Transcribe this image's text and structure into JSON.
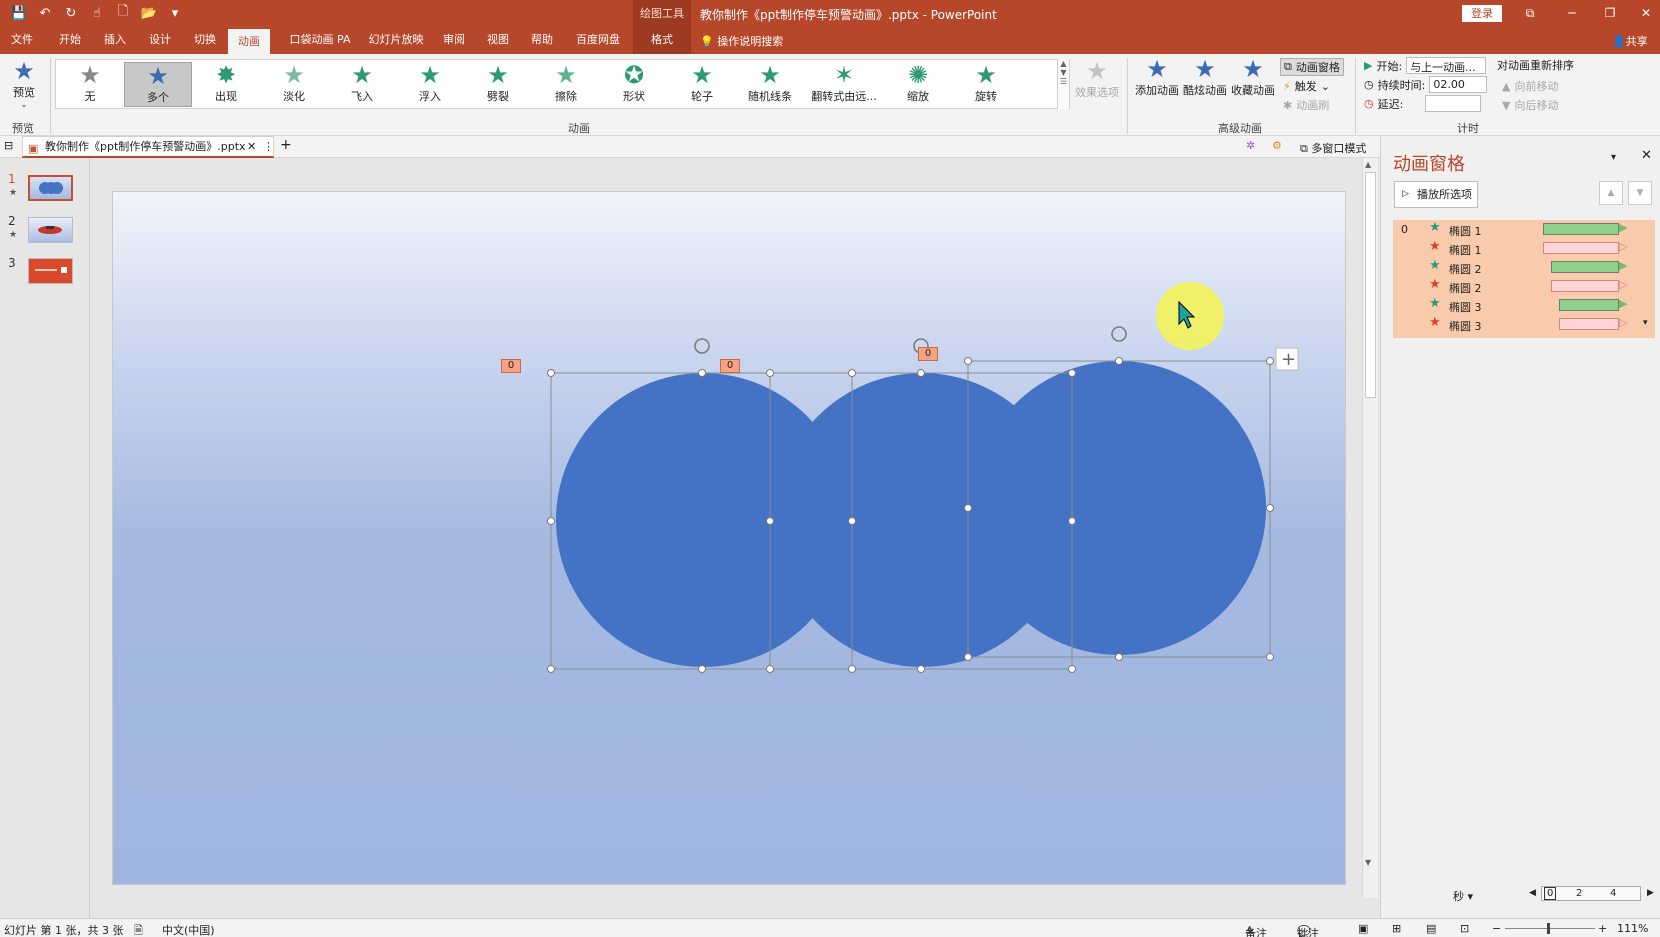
{
  "window": {
    "title": "教你制作《ppt制作停车预警动画》.pptx  -  PowerPoint",
    "context_tool": "绘图工具",
    "login": "登录"
  },
  "tabs": [
    {
      "label": "文件"
    },
    {
      "label": "开始"
    },
    {
      "label": "插入"
    },
    {
      "label": "设计"
    },
    {
      "label": "切换"
    },
    {
      "label": "动画"
    },
    {
      "label": "口袋动画 PA"
    },
    {
      "label": "幻灯片放映"
    },
    {
      "label": "审阅"
    },
    {
      "label": "视图"
    },
    {
      "label": "帮助"
    },
    {
      "label": "百度网盘"
    },
    {
      "label": "格式"
    }
  ],
  "tell_me": "操作说明搜索",
  "share": "共享",
  "ribbon": {
    "preview": {
      "label": "预览",
      "group": "预览"
    },
    "animation_group": "动画",
    "gallery": [
      {
        "label": "无",
        "color": "#888888"
      },
      {
        "label": "多个",
        "color": "#3d6cb3"
      },
      {
        "label": "出现",
        "color": "#2e9a74"
      },
      {
        "label": "淡化",
        "color": "#7fb8a3"
      },
      {
        "label": "飞入",
        "color": "#2e9a74"
      },
      {
        "label": "浮入",
        "color": "#2e9a74"
      },
      {
        "label": "劈裂",
        "color": "#2e9a74"
      },
      {
        "label": "擦除",
        "color": "#5fb38f"
      },
      {
        "label": "形状",
        "color": "#2e9a74"
      },
      {
        "label": "轮子",
        "color": "#2e9a74"
      },
      {
        "label": "随机线条",
        "color": "#2e9a74"
      },
      {
        "label": "翻转式由远...",
        "color": "#2e9a74"
      },
      {
        "label": "缩放",
        "color": "#2e9a74"
      },
      {
        "label": "旋转",
        "color": "#2e9a74"
      }
    ],
    "effect_options": "效果选项",
    "advanced_group": "高级动画",
    "add_animation": "添加动画",
    "cool_animation": "酷炫动画",
    "fav_animation": "收藏动画",
    "animation_pane": "动画窗格",
    "trigger": "触发",
    "animation_painter": "动画刷",
    "timing_group": "计时",
    "start_label": "开始:",
    "start_value": "与上一动画...",
    "duration_label": "持续时间:",
    "duration_value": "02.00",
    "delay_label": "延迟:",
    "delay_value": "",
    "reorder": "对动画重新排序",
    "move_earlier": "向前移动",
    "move_later": "向后移动"
  },
  "doc": {
    "tab_title": "教你制作《ppt制作停车预警动画》.pptx",
    "multiwindow": "多窗口模式"
  },
  "thumbnails": [
    {
      "num": "1",
      "star": "★"
    },
    {
      "num": "2",
      "star": "★"
    },
    {
      "num": "3",
      "star": ""
    }
  ],
  "slide": {
    "tags": [
      "0",
      "0",
      "0"
    ],
    "circle_color": "#4472c4"
  },
  "pane": {
    "title": "动画窗格",
    "play_all": "播放所选项",
    "items": [
      {
        "index": "0",
        "name": "椭圆 1",
        "type": "enter"
      },
      {
        "index": "",
        "name": "椭圆 1",
        "type": "exit"
      },
      {
        "index": "",
        "name": "椭圆 2",
        "type": "enter"
      },
      {
        "index": "",
        "name": "椭圆 2",
        "type": "exit"
      },
      {
        "index": "",
        "name": "椭圆 3",
        "type": "enter"
      },
      {
        "index": "",
        "name": "椭圆 3",
        "type": "exit"
      }
    ],
    "seconds": "秒",
    "timeline": [
      "0",
      "2",
      "4"
    ]
  },
  "status": {
    "slide_info": "幻灯片 第 1 张，共 3 张",
    "language": "中文(中国)",
    "notes": "备注",
    "comments": "批注",
    "zoom": "111%"
  }
}
